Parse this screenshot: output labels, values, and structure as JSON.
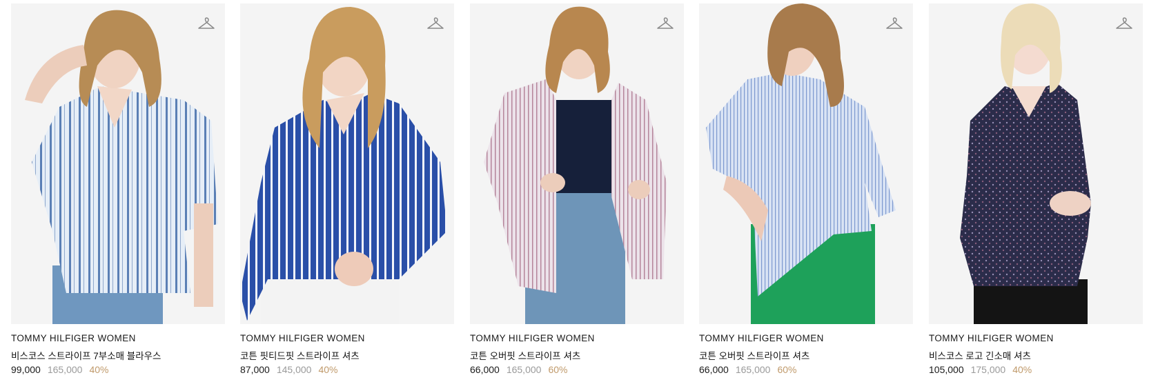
{
  "colors": {
    "discount": "#c09a6b",
    "original_price": "#9a9a9a",
    "image_bg": "#f4f4f4"
  },
  "products": [
    {
      "brand": "TOMMY HILFIGER WOMEN",
      "name": "비스코스 스트라이프 7부소매 블라우스",
      "price": "99,000",
      "original_price": "165,000",
      "discount": "40%",
      "wishlist_icon": "hanger-icon",
      "garment": "light blue and white vertical striped blouse",
      "hair": "blonde"
    },
    {
      "brand": "TOMMY HILFIGER WOMEN",
      "name": "코튼 핏티드핏 스트라이프 셔츠",
      "price": "87,000",
      "original_price": "145,000",
      "discount": "40%",
      "wishlist_icon": "hanger-icon",
      "garment": "royal blue and white striped shirt",
      "hair": "blonde"
    },
    {
      "brand": "TOMMY HILFIGER WOMEN",
      "name": "코튼 오버핏 스트라이프 셔츠",
      "price": "66,000",
      "original_price": "165,000",
      "discount": "60%",
      "wishlist_icon": "hanger-icon",
      "garment": "pink pinstripe oversized shirt over navy top",
      "hair": "blonde"
    },
    {
      "brand": "TOMMY HILFIGER WOMEN",
      "name": "코튼 오버핏 스트라이프 셔츠",
      "price": "66,000",
      "original_price": "165,000",
      "discount": "60%",
      "wishlist_icon": "hanger-icon",
      "garment": "light blue pinstripe shirt with green pants",
      "hair": "light brown"
    },
    {
      "brand": "TOMMY HILFIGER WOMEN",
      "name": "비스코스 로고 긴소매 셔츠",
      "price": "105,000",
      "original_price": "175,000",
      "discount": "40%",
      "wishlist_icon": "hanger-icon",
      "garment": "navy logo print long sleeve shirt",
      "hair": "platinum blonde"
    }
  ]
}
